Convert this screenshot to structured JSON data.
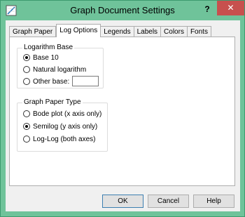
{
  "window": {
    "title": "Graph Document Settings",
    "help_label": "?",
    "close_label": "✕"
  },
  "tabs": [
    {
      "label": "Graph Paper"
    },
    {
      "label": "Log Options"
    },
    {
      "label": "Legends"
    },
    {
      "label": "Labels"
    },
    {
      "label": "Colors"
    },
    {
      "label": "Fonts"
    }
  ],
  "active_tab": "Log Options",
  "logarithm_base": {
    "title": "Logarithm Base",
    "options": [
      {
        "label": "Base 10",
        "checked": true
      },
      {
        "label": "Natural logarithm",
        "checked": false
      },
      {
        "label": "Other base:",
        "checked": false
      }
    ],
    "other_base_value": ""
  },
  "graph_paper_type": {
    "title": "Graph Paper Type",
    "options": [
      {
        "label": "Bode plot (x axis only)",
        "checked": false
      },
      {
        "label": "Semilog (y axis only)",
        "checked": true
      },
      {
        "label": "Log-Log (both axes)",
        "checked": false
      }
    ]
  },
  "buttons": {
    "ok_label": "OK",
    "cancel_label": "Cancel",
    "help_label": "Help"
  },
  "colors": {
    "title_bar": "#6fc39a",
    "close_button": "#c7504e",
    "default_button_border": "#3c7fb1"
  }
}
